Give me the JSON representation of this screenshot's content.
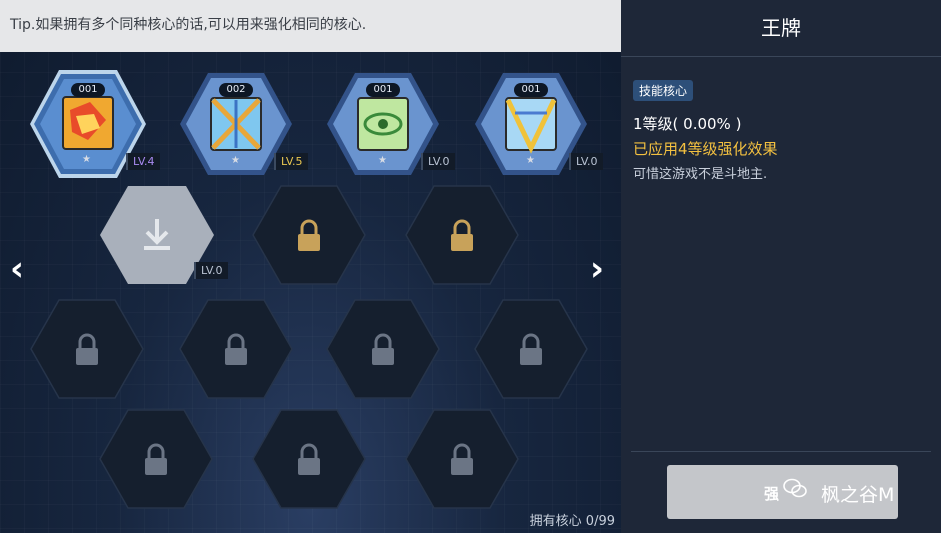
{
  "tip": "Tip.如果拥有多个同种核心的话,可以用来强化相同的核心.",
  "owned_count": "拥有核心 0/99",
  "cores": [
    {
      "id": "001",
      "level": "LV.4",
      "star": "★"
    },
    {
      "id": "002",
      "level": "LV.5",
      "star": "★"
    },
    {
      "id": "001",
      "level": "LV.0",
      "star": "★"
    },
    {
      "id": "001",
      "level": "LV.0",
      "star": "★"
    }
  ],
  "empty_slot_level": "LV.0",
  "nav": {
    "left": "‹",
    "right": "›"
  },
  "panel": {
    "title": "王牌",
    "tag": "技能核心",
    "level_text": "1等级( 0.00% )",
    "applied_text": "已应用4等级强化效果",
    "desc": "可惜这游戏不是斗地主.",
    "button_label": "强",
    "watermark": "枫之谷M"
  },
  "colors": {
    "accent_gold": "#f3c040",
    "panel_bg": "#1e2738",
    "tag_bg": "#2d4f79"
  }
}
